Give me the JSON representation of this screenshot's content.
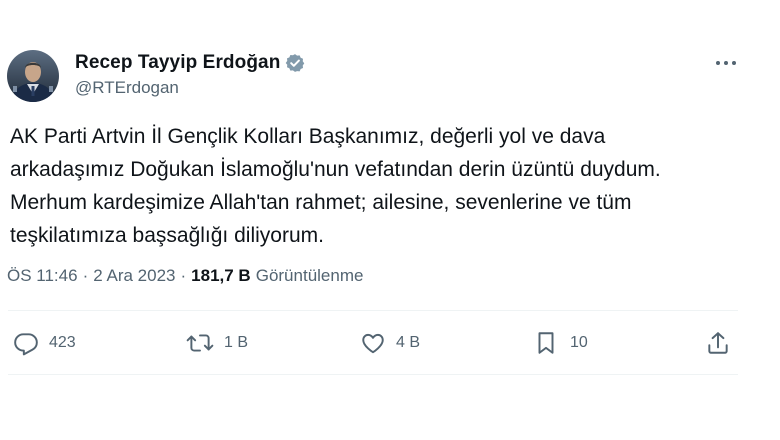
{
  "author": {
    "name": "Recep Tayyip Erdoğan",
    "handle": "@RTErdogan",
    "verified_color": "#829aab"
  },
  "tweet": {
    "text": "AK Parti Artvin İl Gençlik Kolları Başkanımız, değerli yol ve dava\narkadaşımız Doğukan İslamoğlu'nun vefatından derin üzüntü duydum.\nMerhum kardeşimize Allah'tan rahmet; ailesine, sevenlerine ve tüm\nteşkilatımıza başsağlığı diliyorum."
  },
  "meta": {
    "time": "ÖS 11:46",
    "separator": "·",
    "date": "2 Ara 2023",
    "views_count": "181,7 B",
    "views_label": "Görüntülenme"
  },
  "actions": {
    "reply_count": "423",
    "retweet_count": "1 B",
    "like_count": "4 B",
    "bookmark_count": "10"
  },
  "icons": {
    "more": "more-icon",
    "reply": "reply-icon",
    "retweet": "retweet-icon",
    "like": "heart-icon",
    "bookmark": "bookmark-icon",
    "share": "share-icon",
    "verified": "verified-badge-icon"
  },
  "colors": {
    "text": "#0f1419",
    "secondary": "#536471",
    "divider": "#eff3f4"
  }
}
